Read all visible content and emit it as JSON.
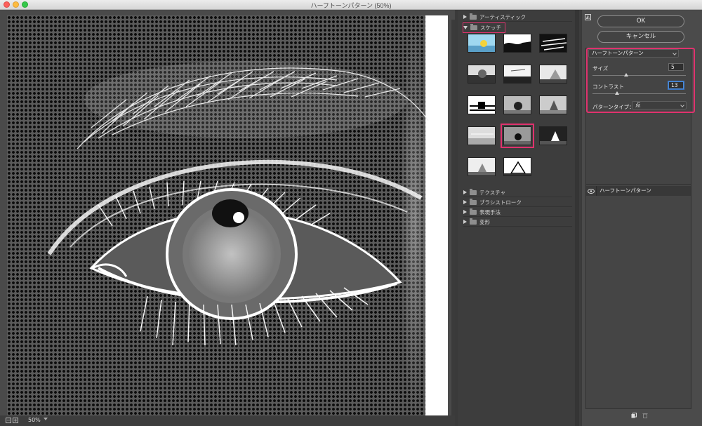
{
  "window": {
    "title": "ハーフトーンパターン (50%)"
  },
  "preview": {
    "zoom": "50%"
  },
  "gallery": {
    "categories": [
      {
        "label": "アーティスティック",
        "expanded": false
      },
      {
        "label": "スケッチ",
        "expanded": true
      },
      {
        "label": "テクスチャ",
        "expanded": false
      },
      {
        "label": "ブラシストローク",
        "expanded": false
      },
      {
        "label": "表現手法",
        "expanded": false
      },
      {
        "label": "変形",
        "expanded": false
      }
    ],
    "selected_thumbnail_index": 10
  },
  "settings": {
    "ok_label": "OK",
    "cancel_label": "キャンセル",
    "filter_name": "ハーフトーンパターン",
    "size_label": "サイズ",
    "size_value": "5",
    "size_range": [
      1,
      12
    ],
    "contrast_label": "コントラスト",
    "contrast_value": "13",
    "contrast_range": [
      0,
      50
    ],
    "pattern_type_label": "パターンタイプ：",
    "pattern_type_value": "点"
  },
  "layers": [
    {
      "name": "ハーフトーンパターン",
      "visible": true
    }
  ],
  "colors": {
    "highlight": "#e0326e",
    "panel": "#4b4b4b",
    "gallery": "#3d3d3d"
  }
}
